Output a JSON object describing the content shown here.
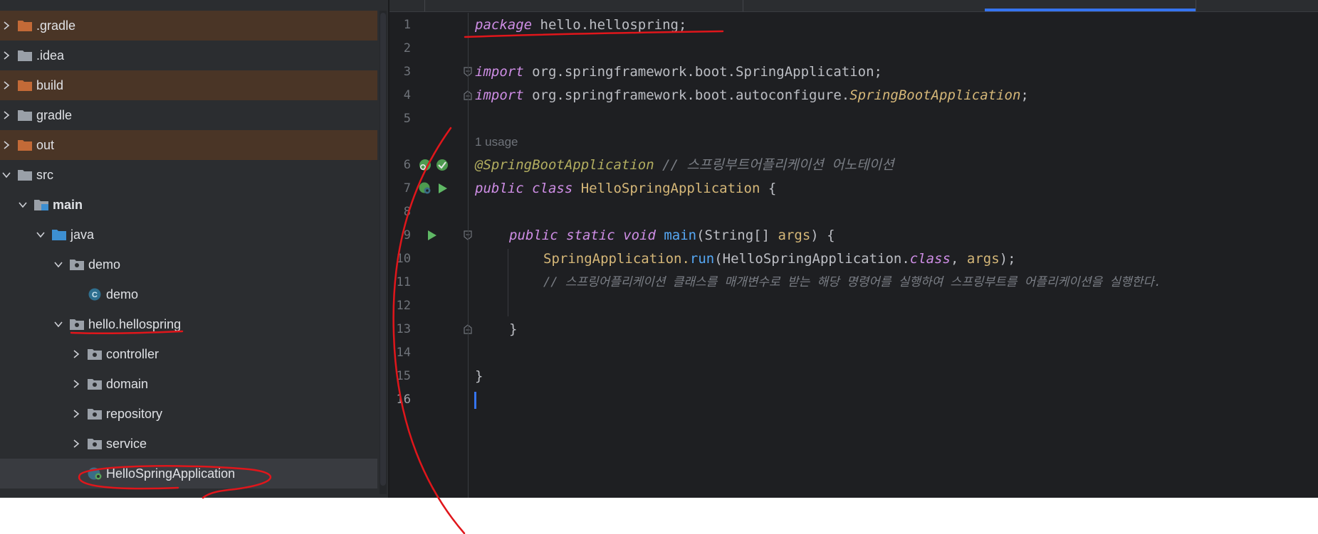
{
  "project_tree": {
    "items": [
      {
        "label": ".gradle"
      },
      {
        "label": ".idea"
      },
      {
        "label": "build"
      },
      {
        "label": "gradle"
      },
      {
        "label": "out"
      },
      {
        "label": "src"
      },
      {
        "label": "main"
      },
      {
        "label": "java"
      },
      {
        "label": "demo"
      },
      {
        "label": "demo"
      },
      {
        "label": "hello.hellospring"
      },
      {
        "label": "controller"
      },
      {
        "label": "domain"
      },
      {
        "label": "repository"
      },
      {
        "label": "service"
      },
      {
        "label": "HelloSpringApplication"
      }
    ]
  },
  "editor": {
    "line_numbers": [
      "1",
      "2",
      "3",
      "4",
      "5",
      "6",
      "7",
      "8",
      "9",
      "10",
      "11",
      "12",
      "13",
      "14",
      "15",
      "16"
    ],
    "current_line": "16",
    "usage_hint": "1 usage",
    "code": {
      "l1_kw": "package",
      "l1_rest": " hello.hellospring;",
      "l3_kw": "import",
      "l3_rest": " org.springframework.boot.SpringApplication;",
      "l4_kw": "import",
      "l4_rest": " org.springframework.boot.autoconfigure.",
      "l4_cls": "SpringBootApplication",
      "l4_end": ";",
      "l6_ann": "@SpringBootApplication",
      "l6_comment": " // 스프링부트어플리케이션 어노테이션",
      "l7_kw": "public class",
      "l7_cls": " HelloSpringApplication",
      "l7_end": " {",
      "l9_kw": "public static void",
      "l9_fn": " main",
      "l9_p1": "(String[] ",
      "l9_param": "args",
      "l9_end": ") {",
      "l10_a": "SpringApplication.",
      "l10_fn": "run",
      "l10_b": "(HelloSpringApplication.",
      "l10_kw": "class",
      "l10_c": ", ",
      "l10_param": "args",
      "l10_end": ");",
      "l11_comment": "// 스프링어플리케이션 클래스를 매개변수로 받는 해당 명령어를 실행하여 스프링부트를 어플리케이션을 실행한다.",
      "l13": "}",
      "l15": "}"
    }
  },
  "colors": {
    "keyword": "#cf8ee6",
    "class_name": "#d5b778",
    "function": "#56a8f5",
    "annotation": "#b3ae60",
    "comment": "#7a7e85",
    "excluded_folder_bg": "#4a3526",
    "selection_bg": "#393b40",
    "annotation_ink": "#e0161b"
  }
}
